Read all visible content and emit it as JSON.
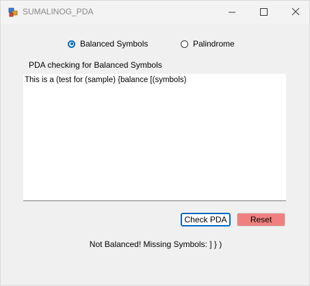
{
  "window": {
    "title": "SUMALINOG_PDA"
  },
  "mode": {
    "options": [
      {
        "label": "Balanced Symbols",
        "checked": true
      },
      {
        "label": "Palindrome",
        "checked": false
      }
    ]
  },
  "section": {
    "label": "PDA checking for Balanced Symbols"
  },
  "input": {
    "value": "This is a (test for (sample) {balance [(symbols)"
  },
  "actions": {
    "check_label": "Check PDA",
    "reset_label": "Reset"
  },
  "result": {
    "text": "Not Balanced! Missing Symbols: ] } )"
  },
  "colors": {
    "accent": "#0067c0",
    "reset_bg": "#f08080"
  }
}
